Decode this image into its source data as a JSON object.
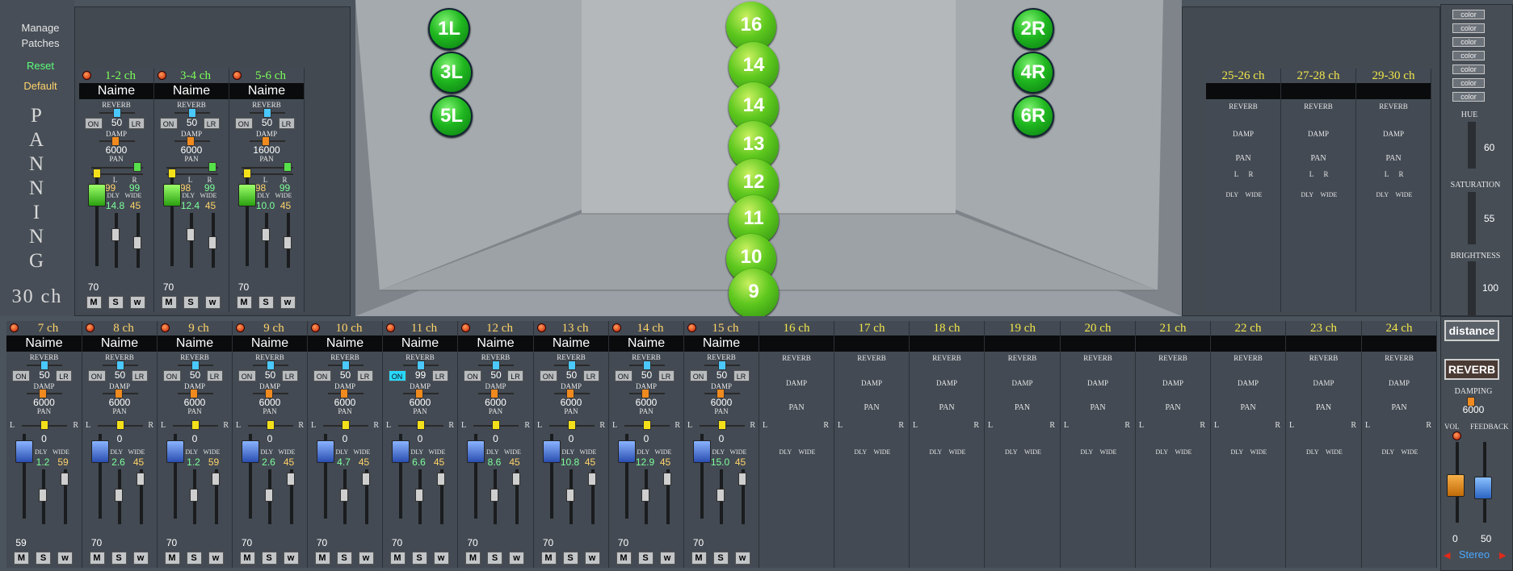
{
  "sidebar": {
    "manage": "Manage",
    "patches": "Patches",
    "reset": "Reset",
    "default": "Default",
    "title_letters": [
      "P",
      "A",
      "N",
      "N",
      "I",
      "N",
      "G"
    ],
    "channels": "30 ch"
  },
  "room_balls": [
    {
      "label": "1L"
    },
    {
      "label": "3L"
    },
    {
      "label": "5L"
    },
    {
      "label": "2R"
    },
    {
      "label": "4R"
    },
    {
      "label": "6R"
    },
    {
      "label": "16"
    },
    {
      "label": "14"
    },
    {
      "label": "14"
    },
    {
      "label": "13"
    },
    {
      "label": "12"
    },
    {
      "label": "11"
    },
    {
      "label": "10"
    },
    {
      "label": "9"
    }
  ],
  "top_strips": [
    {
      "ch": "1-2 ch",
      "name": "Naime",
      "reverb_on": "ON",
      "reverb": "50",
      "lr": "LR",
      "damp": "6000",
      "l": "-99",
      "r": "99",
      "dly": "14.8",
      "wide": "45",
      "vol": "70"
    },
    {
      "ch": "3-4 ch",
      "name": "Naime",
      "reverb_on": "ON",
      "reverb": "50",
      "lr": "LR",
      "damp": "6000",
      "l": "-98",
      "r": "99",
      "dly": "12.4",
      "wide": "45",
      "vol": "70"
    },
    {
      "ch": "5-6 ch",
      "name": "Naime",
      "reverb_on": "ON",
      "reverb": "50",
      "lr": "LR",
      "damp": "16000",
      "l": "-98",
      "r": "99",
      "dly": "10.0",
      "wide": "45",
      "vol": "70"
    }
  ],
  "labels": {
    "reverb": "REVERB",
    "damp": "DAMP",
    "pan": "PAN",
    "l": "L",
    "r": "R",
    "dly": "DLY",
    "wide": "WIDE",
    "m": "M",
    "s": "S",
    "w": "w"
  },
  "right_top_strips": [
    {
      "ch": "25-26 ch"
    },
    {
      "ch": "27-28 ch"
    },
    {
      "ch": "29-30 ch"
    }
  ],
  "bottom_strips": [
    {
      "ch": "7 ch",
      "name": "Naime",
      "on": "ON",
      "reverb": "50",
      "damp": "6000",
      "pan": "0",
      "dly": "1.2",
      "wide": "59",
      "vol": "59",
      "active": true
    },
    {
      "ch": "8 ch",
      "name": "Naime",
      "on": "ON",
      "reverb": "50",
      "damp": "6000",
      "pan": "0",
      "dly": "2.6",
      "wide": "45",
      "vol": "70",
      "active": true
    },
    {
      "ch": "9 ch",
      "name": "Naime",
      "on": "ON",
      "reverb": "50",
      "damp": "6000",
      "pan": "0",
      "dly": "1.2",
      "wide": "59",
      "vol": "70",
      "active": true
    },
    {
      "ch": "9 ch",
      "name": "Naime",
      "on": "ON",
      "reverb": "50",
      "damp": "6000",
      "pan": "0",
      "dly": "2.6",
      "wide": "45",
      "vol": "70",
      "active": true
    },
    {
      "ch": "10 ch",
      "name": "Naime",
      "on": "ON",
      "reverb": "50",
      "damp": "6000",
      "pan": "0",
      "dly": "4.7",
      "wide": "45",
      "vol": "70",
      "active": true
    },
    {
      "ch": "11 ch",
      "name": "Naime",
      "on": "ON",
      "reverb": "99",
      "damp": "6000",
      "pan": "0",
      "dly": "6.6",
      "wide": "45",
      "vol": "70",
      "active": true,
      "on_lit": true
    },
    {
      "ch": "12 ch",
      "name": "Naime",
      "on": "ON",
      "reverb": "50",
      "damp": "6000",
      "pan": "0",
      "dly": "8.6",
      "wide": "45",
      "vol": "70",
      "active": true
    },
    {
      "ch": "13 ch",
      "name": "Naime",
      "on": "ON",
      "reverb": "50",
      "damp": "6000",
      "pan": "0",
      "dly": "10.8",
      "wide": "45",
      "vol": "70",
      "active": true
    },
    {
      "ch": "14 ch",
      "name": "Naime",
      "on": "ON",
      "reverb": "50",
      "damp": "6000",
      "pan": "0",
      "dly": "12.9",
      "wide": "45",
      "vol": "70",
      "active": true
    },
    {
      "ch": "15 ch",
      "name": "Naime",
      "on": "ON",
      "reverb": "50",
      "damp": "6000",
      "pan": "0",
      "dly": "15.0",
      "wide": "45",
      "vol": "70",
      "active": true
    },
    {
      "ch": "16 ch"
    },
    {
      "ch": "17 ch"
    },
    {
      "ch": "18 ch"
    },
    {
      "ch": "19 ch"
    },
    {
      "ch": "20 ch"
    },
    {
      "ch": "21 ch"
    },
    {
      "ch": "22 ch"
    },
    {
      "ch": "23 ch"
    },
    {
      "ch": "24 ch"
    }
  ],
  "color_panel": {
    "buttons": [
      "color",
      "color",
      "color",
      "color",
      "color",
      "color",
      "color"
    ],
    "hue_label": "HUE",
    "hue": "60",
    "sat_label": "SATURATION",
    "sat": "55",
    "bright_label": "BRIGHTNESS",
    "bright": "100"
  },
  "master": {
    "distance": "distance",
    "reverb": "REVERB",
    "damping_label": "DAMPING",
    "damping": "6000",
    "vol_label": "VOL",
    "feedback_label": "FEEDBACK",
    "vol": "0",
    "feedback": "50",
    "mode": "Stereo"
  },
  "colors": {
    "ch_label_green": "#7dff5a",
    "ch_label_yellow": "#f2e64a",
    "reset": "#5dff7a",
    "default": "#ffd36a"
  }
}
